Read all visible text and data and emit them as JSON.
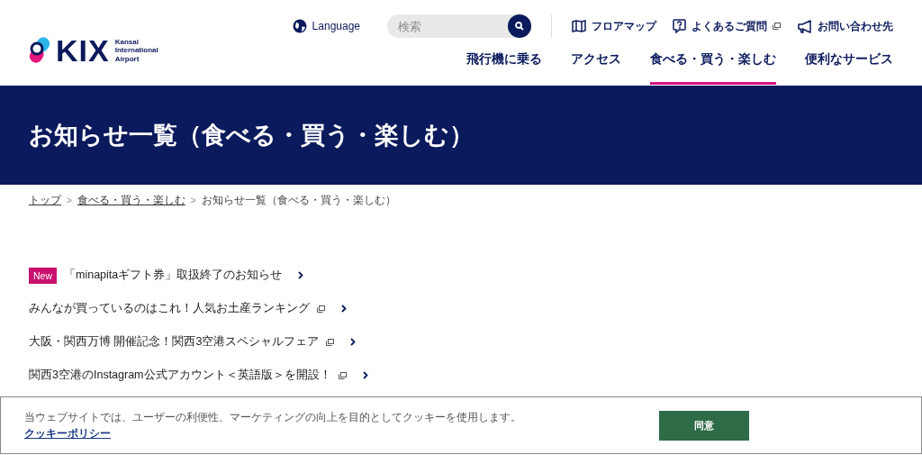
{
  "header": {
    "logo": {
      "wordmark": "KIX",
      "subtitle": [
        "Kansai",
        "International",
        "Airport"
      ]
    },
    "language": "Language",
    "search": {
      "placeholder": "検索"
    },
    "utility_links": [
      {
        "kind": "map",
        "label": "フロアマップ",
        "external": false
      },
      {
        "kind": "faq",
        "label": "よくあるご質問",
        "external": true
      },
      {
        "kind": "contact",
        "label": "お問い合わせ先",
        "external": false
      }
    ],
    "nav": [
      {
        "label": "飛行機に乗る",
        "selected": false
      },
      {
        "label": "アクセス",
        "selected": false
      },
      {
        "label": "食べる・買う・楽しむ",
        "selected": true
      },
      {
        "label": "便利なサービス",
        "selected": false
      }
    ]
  },
  "page_title": "お知らせ一覧（食べる・買う・楽しむ）",
  "breadcrumb": [
    {
      "label": "トップ",
      "link": true
    },
    {
      "label": "食べる・買う・楽しむ",
      "link": true
    },
    {
      "label": "お知らせ一覧（食べる・買う・楽しむ）",
      "link": false
    }
  ],
  "breadcrumb_separator": ">",
  "news": [
    {
      "badge": "New",
      "title": "「minapitaギフト券」取扱終了のお知らせ",
      "external": false
    },
    {
      "title": "みんなが買っているのはこれ！人気お土産ランキング",
      "external": true
    },
    {
      "title": "大阪・関西万博 開催記念！関西3空港スペシャルフェア",
      "external": true
    },
    {
      "title": "関西3空港のInstagram公式アカウント＜英語版＞を開設！",
      "external": true
    }
  ],
  "cookie_banner": {
    "text": "当ウェブサイトでは、ユーザーの利便性、マーケティングの向上を目的としてクッキーを使用します。",
    "link": "クッキーポリシー",
    "button": "同意"
  }
}
